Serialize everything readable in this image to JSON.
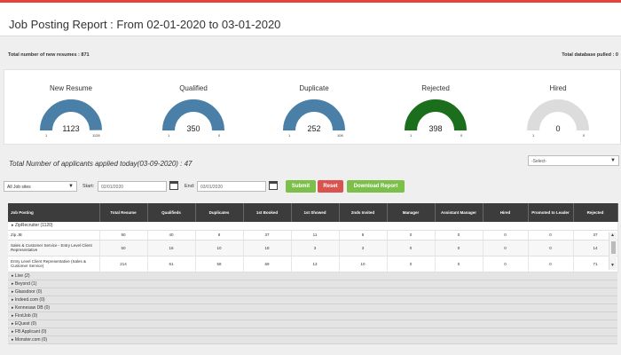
{
  "header": {
    "title": "Job Posting Report : From 02-01-2020 to 03-01-2020"
  },
  "totals": {
    "new_resumes": "Total number of new resumes : 871",
    "database_pulled": "Total database pulled : 0"
  },
  "gauges": [
    {
      "label": "New Resume",
      "value": "1123",
      "min": "1",
      "max": "1128",
      "fraction": 0.995,
      "color": "#4a7fa8"
    },
    {
      "label": "Qualified",
      "value": "350",
      "min": "1",
      "max": "0",
      "fraction": 1.0,
      "color": "#4a7fa8"
    },
    {
      "label": "Duplicate",
      "value": "252",
      "min": "1",
      "max": "106",
      "fraction": 1.0,
      "color": "#4a7fa8"
    },
    {
      "label": "Rejected",
      "value": "398",
      "min": "1",
      "max": "0",
      "fraction": 1.0,
      "color": "#1b6e1b"
    },
    {
      "label": "Hired",
      "value": "0",
      "min": "1",
      "max": "0",
      "fraction": 0.0,
      "color": "#d8d8d8"
    }
  ],
  "applied": "Total Number of applicants applied today(03-09-2020) : 47",
  "select_right": {
    "value": "-Select-"
  },
  "filters": {
    "job_sites": "All Job sites",
    "start_label": "Start:",
    "start_value": "02/01/2020",
    "end_label": "End:",
    "end_value": "03/01/2020",
    "submit": "Submit",
    "reset": "Reset",
    "download": "Download Report"
  },
  "table": {
    "headers": [
      "Job Posting",
      "Total Resume",
      "Qualifieds",
      "Duplicates",
      "1st Booked",
      "1st Showed",
      "2nds Invited",
      "Manager",
      "Assistant Manager",
      "Hired",
      "Promoted to Leader",
      "Rejected"
    ],
    "group": "▸ ZipRecruiter (1120)",
    "rows": [
      [
        "Zip JB",
        "90",
        "40",
        "8",
        "37",
        "11",
        "8",
        "0",
        "0",
        "0",
        "0",
        "37"
      ],
      [
        "Sales & Customer Service - Entry Level Client Representative",
        "50",
        "16",
        "10",
        "18",
        "3",
        "3",
        "0",
        "0",
        "0",
        "0",
        "14"
      ],
      [
        "Entry Level Client Representative (Sales & Customer Service)",
        "214",
        "61",
        "58",
        "69",
        "13",
        "10",
        "0",
        "0",
        "0",
        "0",
        "71"
      ]
    ],
    "sources": [
      "▸ Live (2)",
      "▸ Beyond (1)",
      "▸ Glassdoor (0)",
      "▸ Indeed.com (0)",
      "▸ Kennesaw DB (0)",
      "▸ FirstJob (0)",
      "▸ EQuest (0)",
      "▸ FB Applicant (0)",
      "▸ Monster.com (0)"
    ]
  }
}
